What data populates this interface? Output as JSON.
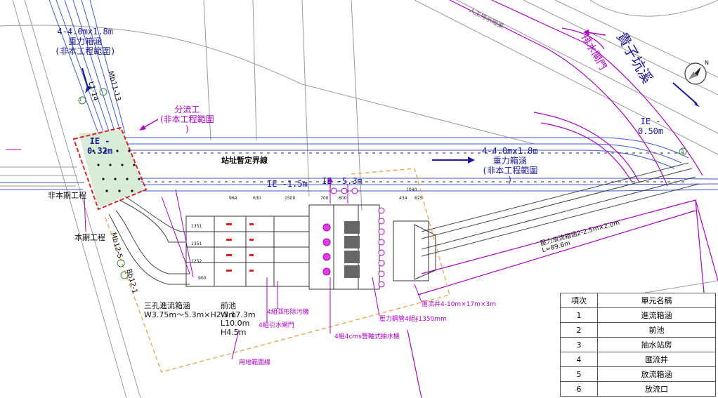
{
  "labels": {
    "box_culvert_top_left": [
      "4-4.0mx1.8m",
      "重力箱涵",
      "(非本工程範圍)"
    ],
    "box_culvert_right": [
      "4-4.0mx1.8m",
      "重力箱涵",
      "(非本工程範圍"
    ],
    "diversion_work": [
      "分流工",
      "(非本工程範圍",
      ")"
    ],
    "ie_left": [
      "IE -",
      "0.32m"
    ],
    "ie_right": [
      "IE -",
      "0.50m"
    ],
    "ie_mid_1": "IE -1.5m",
    "ie_mid_2": "IE -5.3m",
    "site_boundary": "站址暫定界線",
    "not_this_phase": "非本期工程",
    "this_phase": "本期工程",
    "drain_gate": "排水閘門",
    "creek_name": "貴子坑溪",
    "north": "N",
    "mb11_13": "Mb11-13",
    "mb12_5": "Mb12-5",
    "bb12_1": "Bb12-1",
    "l1_14": "L1-14",
    "intake_culvert": [
      "三孔進流箱涵",
      "W3.75m～5.3m×H2.5m"
    ],
    "forebay": [
      "前池",
      "W 17.3m",
      "L10.0m",
      "H4.5m"
    ],
    "bar_screen": "4組弧形除污機",
    "gate": "4組引水閘門",
    "pump": "4組4cms豎軸式抽水機",
    "pipe": "壓力鋼管4組∮1350mm",
    "converge_well": "匯流井4-10m×17m×3m",
    "land_line": "用地範圍線",
    "outflow_culvert": [
      "壓力放流箱涵2-2.5m×2.0m",
      "L=89.6m"
    ],
    "dims": [
      "964",
      "630",
      "1500",
      "700",
      "600",
      "1040",
      "434",
      "625",
      "1351",
      "1351",
      "1252",
      "900"
    ],
    "road_text": "人工排水暗渠",
    "circle_1": "1",
    "circle_5": "5"
  },
  "legend": {
    "header": [
      "項次",
      "單元名稱"
    ],
    "rows": [
      [
        "1",
        "進流箱涵"
      ],
      [
        "2",
        "前池"
      ],
      [
        "3",
        "抽水站房"
      ],
      [
        "4",
        "匯流井"
      ],
      [
        "5",
        "放流箱涵"
      ],
      [
        "6",
        "放流口"
      ]
    ]
  },
  "colors": {
    "navy": "#1a1a9c",
    "purple": "#b000c8",
    "orange": "#f0a040",
    "red": "#e02020",
    "green_fill": "#d8ecd8",
    "blue_line": "#3a5ad8"
  }
}
